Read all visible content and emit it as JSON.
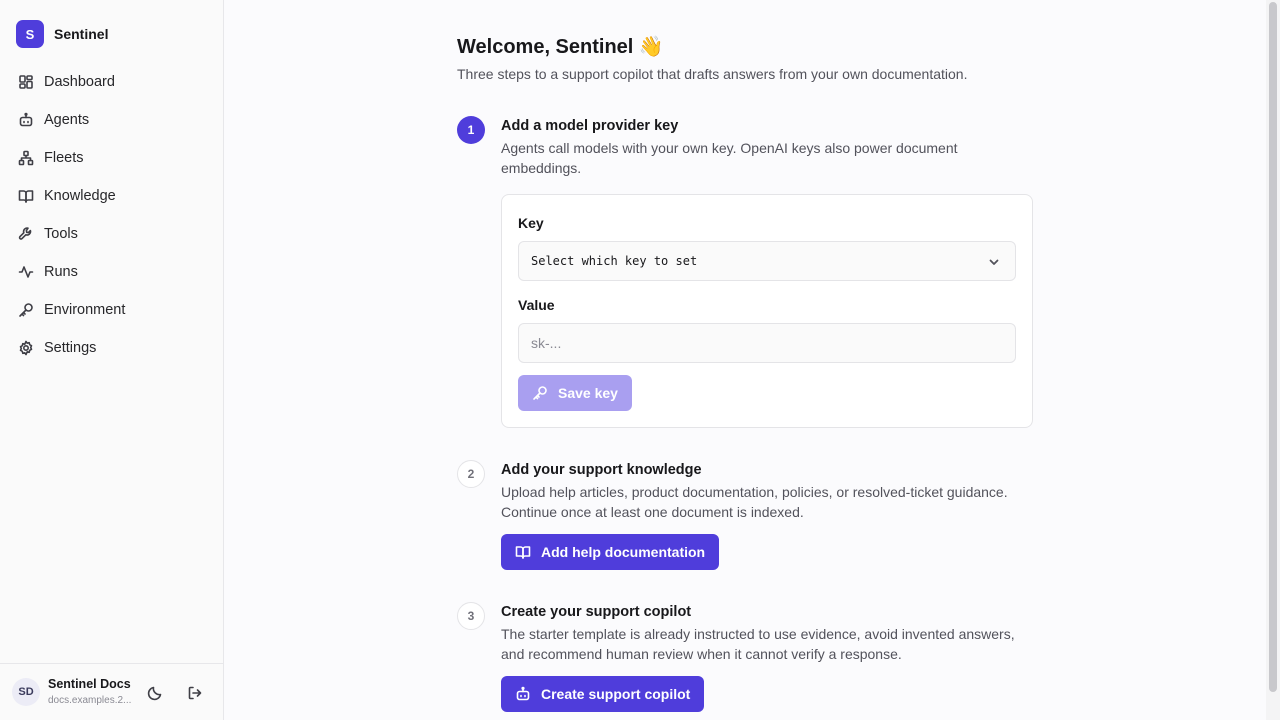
{
  "brand": {
    "logo_letter": "S",
    "name": "Sentinel",
    "accent": "#4f3ddb"
  },
  "sidebar": {
    "items": [
      {
        "label": "Dashboard",
        "icon": "dashboard-icon"
      },
      {
        "label": "Agents",
        "icon": "bot-icon"
      },
      {
        "label": "Fleets",
        "icon": "network-icon"
      },
      {
        "label": "Knowledge",
        "icon": "book-icon"
      },
      {
        "label": "Tools",
        "icon": "wrench-icon"
      },
      {
        "label": "Runs",
        "icon": "activity-icon"
      },
      {
        "label": "Environment",
        "icon": "key-icon"
      },
      {
        "label": "Settings",
        "icon": "gear-icon"
      }
    ]
  },
  "user": {
    "initials": "SD",
    "name": "Sentinel Docs",
    "subtitle": "docs.examples.2..."
  },
  "main": {
    "title": "Welcome, Sentinel 👋",
    "subtitle": "Three steps to a support copilot that drafts answers from your own documentation."
  },
  "steps": [
    {
      "number": "1",
      "title": "Add a model provider key",
      "description": "Agents call models with your own key. OpenAI keys also power document embeddings.",
      "form": {
        "key_label": "Key",
        "key_select_value": "Select which key to set",
        "value_label": "Value",
        "value_placeholder": "sk-...",
        "save_label": "Save key"
      }
    },
    {
      "number": "2",
      "title": "Add your support knowledge",
      "description": "Upload help articles, product documentation, policies, or resolved-ticket guidance. Continue once at least one document is indexed.",
      "button_label": "Add help documentation"
    },
    {
      "number": "3",
      "title": "Create your support copilot",
      "description": "The starter template is already instructed to use evidence, avoid invented answers, and recommend human review when it cannot verify a response.",
      "button_label": "Create support copilot"
    }
  ]
}
